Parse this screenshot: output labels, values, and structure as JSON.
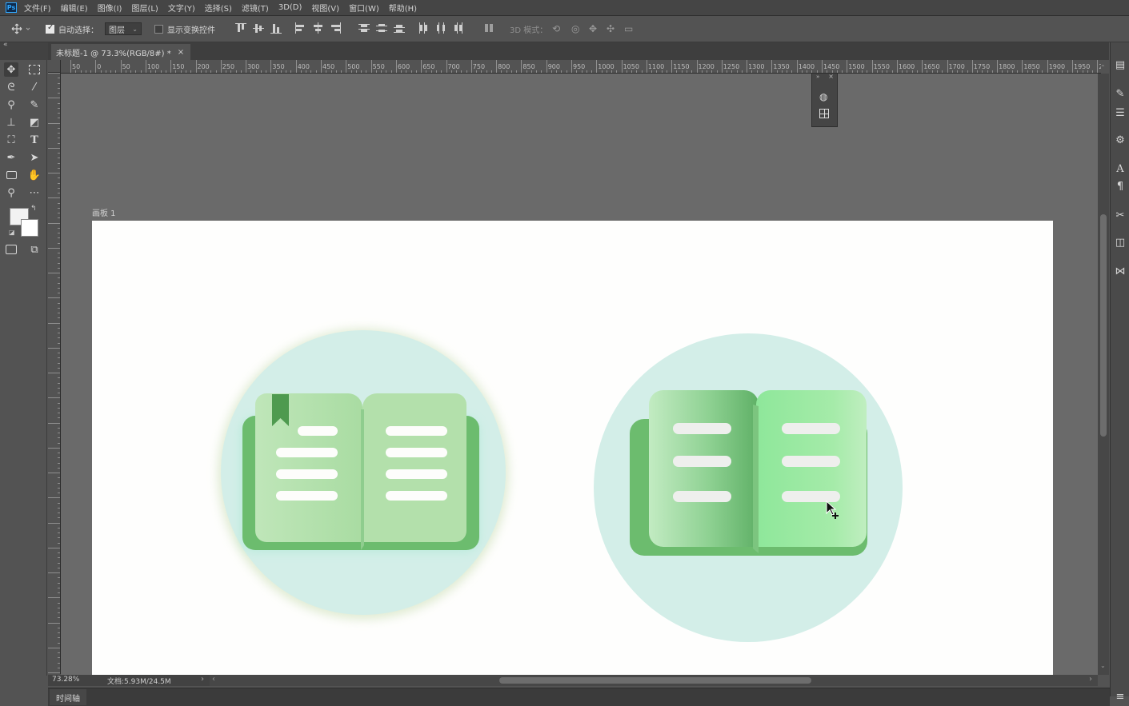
{
  "app": {
    "logo": "Ps"
  },
  "menu": [
    "文件(F)",
    "编辑(E)",
    "图像(I)",
    "图层(L)",
    "文字(Y)",
    "选择(S)",
    "滤镜(T)",
    "3D(D)",
    "视图(V)",
    "窗口(W)",
    "帮助(H)"
  ],
  "options": {
    "auto_select_label": "自动选择：",
    "auto_select_checked": true,
    "layer_select_value": "图层",
    "show_transform_label": "显示变换控件",
    "show_transform_checked": false,
    "mode_3d_label": "3D 模式："
  },
  "document": {
    "tab_title": "未标题-1 @ 73.3%(RGB/8#) *",
    "artboard_label": "画板 1"
  },
  "ruler": {
    "h_labels": [
      "50",
      "0",
      "50",
      "100",
      "150",
      "200",
      "250",
      "300",
      "350",
      "400",
      "450",
      "500",
      "550",
      "600",
      "650",
      "700",
      "750",
      "800",
      "850",
      "900",
      "950",
      "1000",
      "1050",
      "1100",
      "1150",
      "1200",
      "1250",
      "1300",
      "1350",
      "1400",
      "1450",
      "1500",
      "1550",
      "1600",
      "1650",
      "1700",
      "1750",
      "1800",
      "1850",
      "1900",
      "1950",
      "2"
    ]
  },
  "status": {
    "zoom": "73.28%",
    "doc_info": "文档:5.93M/24.5M"
  },
  "bottom_panel": {
    "timeline_tab": "时间轴"
  },
  "colors": {
    "circle_bg": "#d3eee8",
    "book_dark": "#6bbd6f",
    "book_light": "#b4e2ad",
    "accent_green": "#4e9a4f"
  }
}
